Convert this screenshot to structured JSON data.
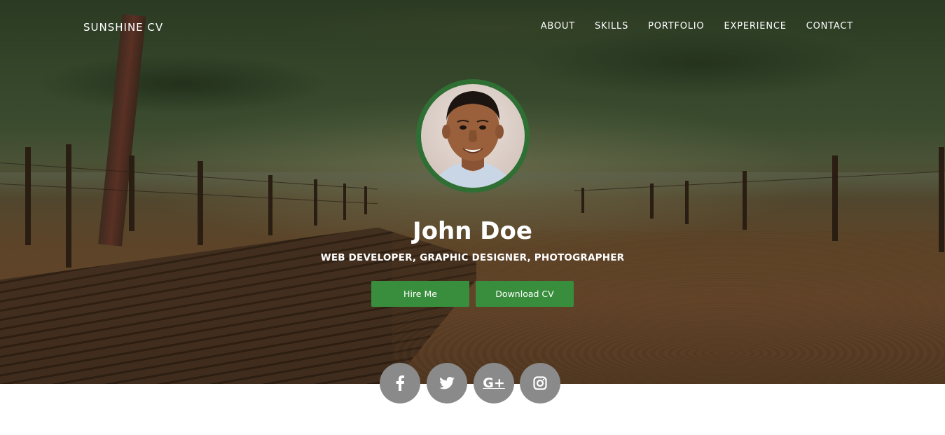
{
  "header": {
    "brand": "SUNSHINE CV",
    "nav": [
      "ABOUT",
      "SKILLS",
      "PORTFOLIO",
      "EXPERIENCE",
      "CONTACT"
    ]
  },
  "hero": {
    "name": "John Doe",
    "title": "WEB DEVELOPER, GRAPHIC DESIGNER, PHOTOGRAPHER",
    "buttons": {
      "hire": "Hire Me",
      "download": "Download CV"
    }
  },
  "social": {
    "icons": [
      "facebook-icon",
      "twitter-icon",
      "google-plus-icon",
      "instagram-icon"
    ],
    "google_plus_glyph": "G+"
  },
  "colors": {
    "accent": "#388e3c",
    "avatar_ring": "#2f6f34",
    "social_bg": "#8a8a8a",
    "text": "#ffffff"
  }
}
